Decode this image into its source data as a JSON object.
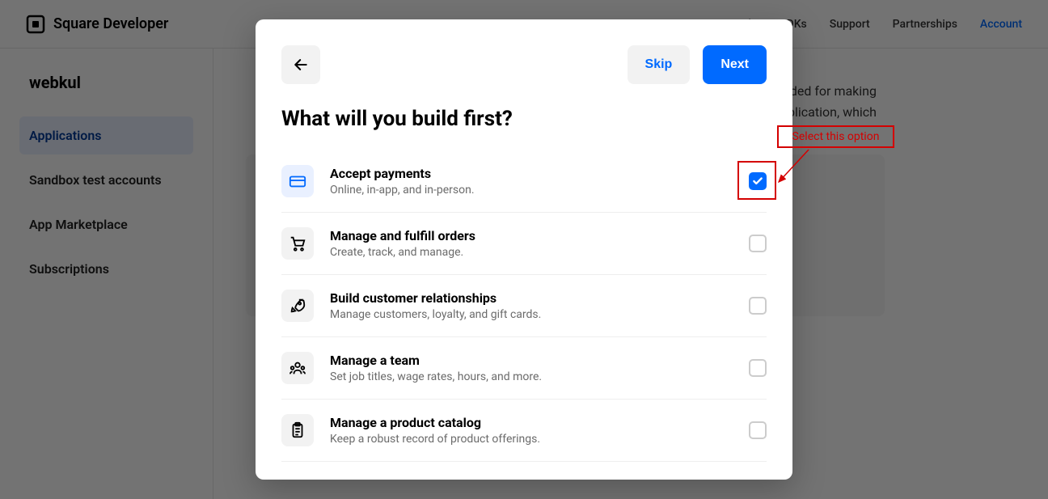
{
  "brand": {
    "name": "Square Developer"
  },
  "topnav": {
    "items": [
      "ls",
      "SDKs",
      "Support",
      "Partnerships",
      "Account"
    ],
    "active_index": 4
  },
  "sidebar": {
    "org_name": "webkul",
    "items": [
      {
        "label": "Applications",
        "active": true
      },
      {
        "label": "Sandbox test accounts",
        "active": false
      },
      {
        "label": "App Marketplace",
        "active": false
      },
      {
        "label": "Subscriptions",
        "active": false
      }
    ]
  },
  "main": {
    "desc_fragment_1": "s needed for making",
    "desc_fragment_2": "application, which"
  },
  "modal": {
    "title": "What will you build first?",
    "skip_label": "Skip",
    "next_label": "Next",
    "options": [
      {
        "title": "Accept payments",
        "subtitle": "Online, in-app, and in-person.",
        "checked": true,
        "icon": "card-icon"
      },
      {
        "title": "Manage and fulfill orders",
        "subtitle": "Create, track, and manage.",
        "checked": false,
        "icon": "cart-icon"
      },
      {
        "title": "Build customer relationships",
        "subtitle": "Manage customers, loyalty, and gift cards.",
        "checked": false,
        "icon": "rocket-icon"
      },
      {
        "title": "Manage a team",
        "subtitle": "Set job titles, wage rates, hours, and more.",
        "checked": false,
        "icon": "people-icon"
      },
      {
        "title": "Manage a product catalog",
        "subtitle": "Keep a robust record of product offerings.",
        "checked": false,
        "icon": "clipboard-icon"
      }
    ]
  },
  "annotation": {
    "label": "Select this option"
  }
}
